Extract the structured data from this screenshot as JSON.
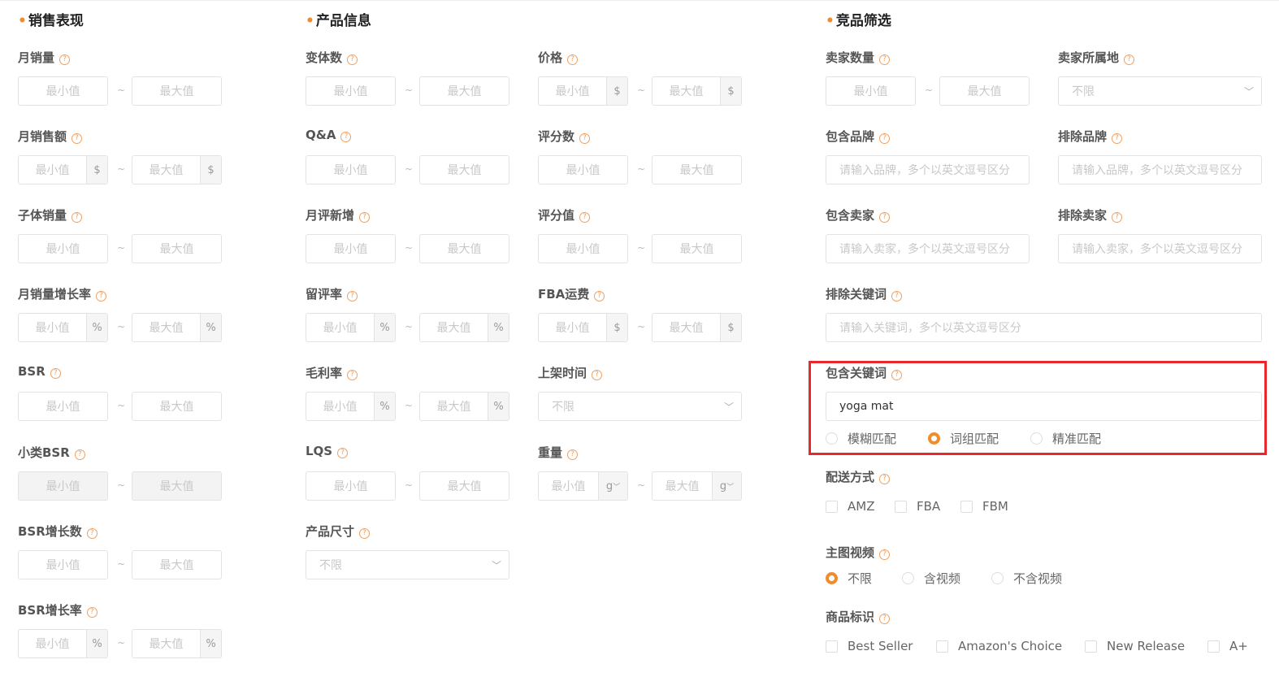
{
  "sections": {
    "sales": "销售表现",
    "product": "产品信息",
    "competitor": "竞品筛选"
  },
  "placeholders": {
    "min": "最小值",
    "max": "最大值",
    "min_trunc": "最小值",
    "max_trunc": "最大值",
    "unlimited": "不限",
    "brand": "请输入品牌，多个以英文逗号区分",
    "seller": "请输入卖家，多个以英文逗号区分",
    "keyword": "请输入关键词，多个以英文逗号区分"
  },
  "units": {
    "dollar": "$",
    "percent": "%",
    "gram": "g"
  },
  "sales_fields": {
    "monthly_sales": "月销量",
    "monthly_revenue": "月销售额",
    "child_sales": "子体销量",
    "sales_growth_rate": "月销量增长率",
    "bsr": "BSR",
    "sub_bsr": "小类BSR",
    "bsr_growth": "BSR增长数",
    "bsr_growth_rate": "BSR增长率"
  },
  "product_fields": {
    "variants": "变体数",
    "qa": "Q&A",
    "monthly_reviews": "月评新增",
    "review_rate": "留评率",
    "gross_margin": "毛利率",
    "lqs": "LQS",
    "size": "产品尺寸",
    "price": "价格",
    "rating_count": "评分数",
    "rating": "评分值",
    "fba_fee": "FBA运费",
    "listing_time": "上架时间",
    "weight": "重量"
  },
  "competitor_fields": {
    "seller_count": "卖家数量",
    "seller_location": "卖家所属地",
    "include_brand": "包含品牌",
    "exclude_brand": "排除品牌",
    "include_seller": "包含卖家",
    "exclude_seller": "排除卖家",
    "exclude_keyword": "排除关键词",
    "include_keyword": "包含关键词",
    "include_keyword_value": "yoga mat",
    "match_fuzzy": "模糊匹配",
    "match_phrase": "词组匹配",
    "match_exact": "精准匹配",
    "delivery": "配送方式",
    "delivery_amz": "AMZ",
    "delivery_fba": "FBA",
    "delivery_fbm": "FBM",
    "video": "主图视频",
    "video_any": "不限",
    "video_yes": "含视频",
    "video_no": "不含视频",
    "badge": "商品标识",
    "badge_best": "Best Seller",
    "badge_choice": "Amazon's Choice",
    "badge_new": "New Release",
    "badge_aplus": "A+"
  },
  "help_icon": "?",
  "chevron": "﹀",
  "accent_color": "#f08c2b",
  "highlight_color": "#e8282d"
}
